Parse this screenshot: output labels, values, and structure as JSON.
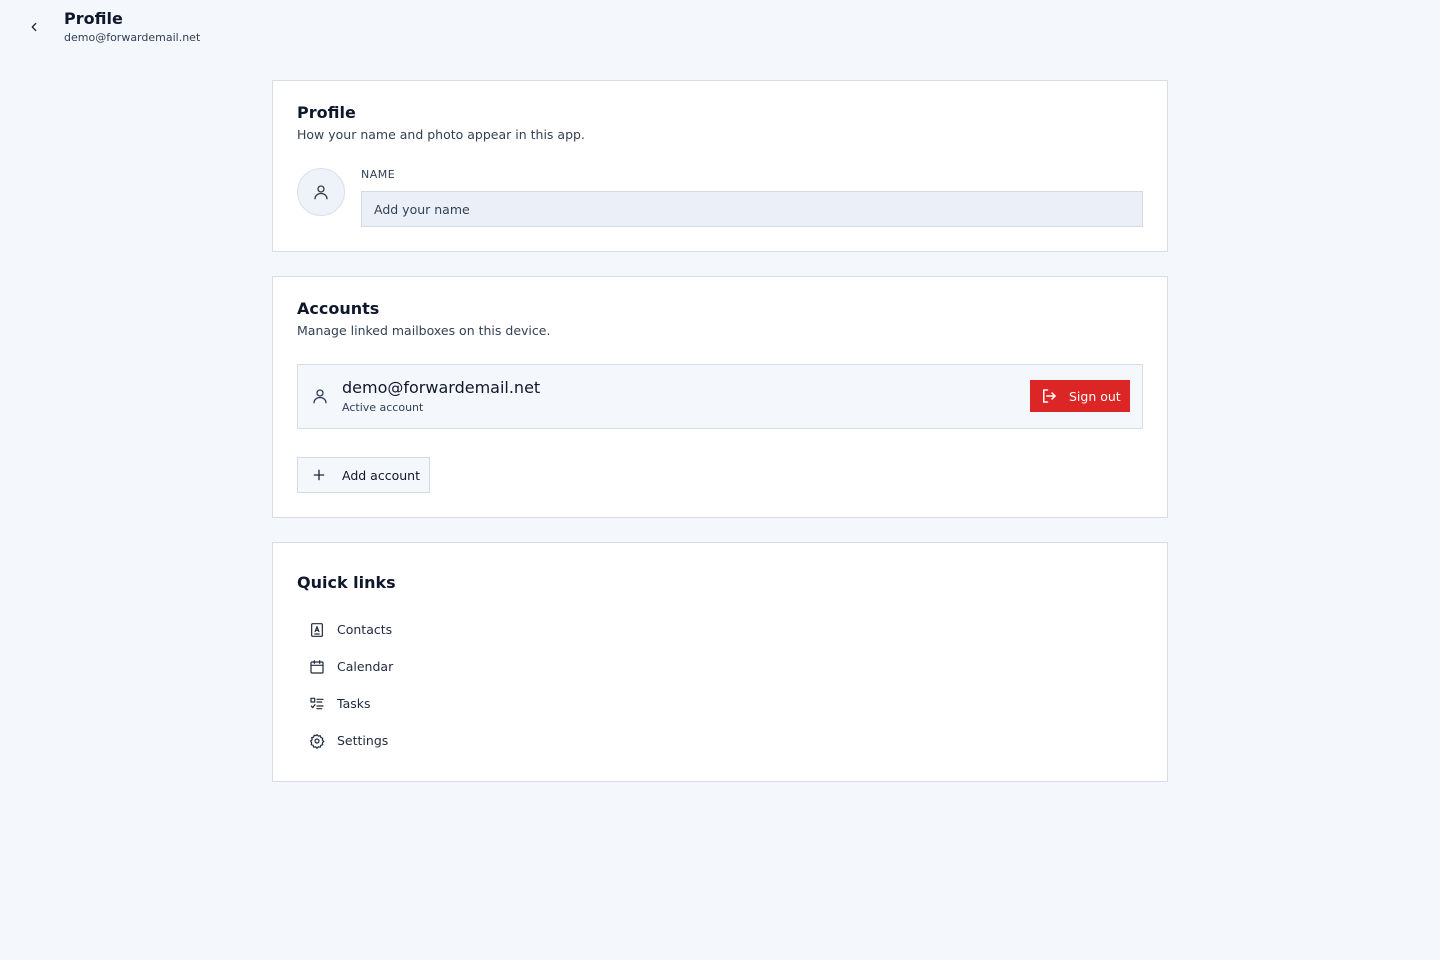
{
  "header": {
    "title": "Profile",
    "subtitle": "demo@forwardemail.net",
    "back_icon": "chevron-left-icon"
  },
  "profile_card": {
    "title": "Profile",
    "description": "How your name and photo appear in this app.",
    "avatar_icon": "user-icon",
    "name_label": "NAME",
    "name_value": "",
    "name_placeholder": "Add your name"
  },
  "accounts_card": {
    "title": "Accounts",
    "description": "Manage linked mailboxes on this device.",
    "accounts": [
      {
        "email": "demo@forwardemail.net",
        "status": "Active account",
        "icon": "user-icon",
        "action_label": "Sign out",
        "action_icon": "sign-out-icon"
      }
    ],
    "add_label": "Add account",
    "add_icon": "plus-icon"
  },
  "quick_links": {
    "title": "Quick links",
    "items": [
      {
        "label": "Contacts",
        "icon": "contacts-icon"
      },
      {
        "label": "Calendar",
        "icon": "calendar-icon"
      },
      {
        "label": "Tasks",
        "icon": "tasks-icon"
      },
      {
        "label": "Settings",
        "icon": "gear-icon"
      }
    ]
  },
  "colors": {
    "background": "#f4f7fc",
    "card": "#ffffff",
    "danger": "#dc2626",
    "text": "#0f172a"
  }
}
